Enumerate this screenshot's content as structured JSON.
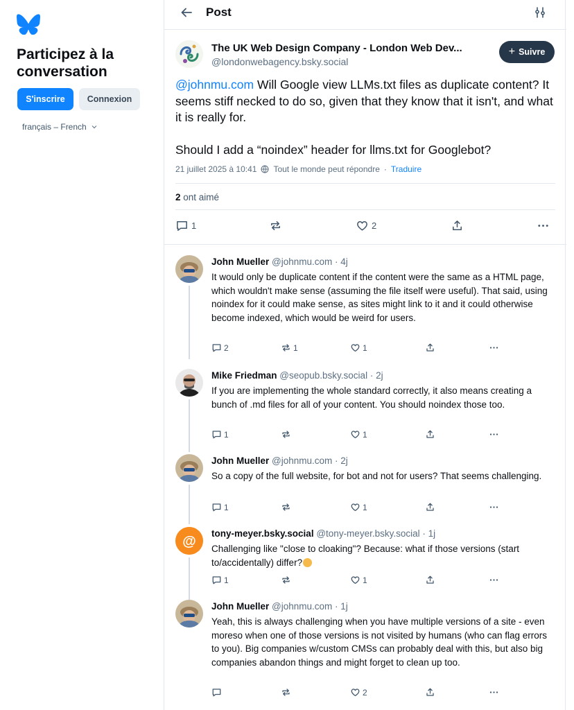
{
  "sidebar": {
    "title": "Participez à la conversation",
    "signup_label": "S'inscrire",
    "login_label": "Connexion",
    "language": "français – French"
  },
  "header": {
    "title": "Post"
  },
  "post": {
    "author_name": "The UK Web Design Company - London Web Dev...",
    "author_handle": "@londonwebagency.bsky.social",
    "follow_label": "Suivre",
    "mention": "@johnmu.com",
    "text_part1": " Will Google view LLMs.txt files as duplicate content? It seems stiff necked to do so, given that they know that it isn't, and what it is really for.",
    "text_part2": "Should I add a “noindex” header for llms.txt for Googlebot?",
    "date": "21 juillet 2025 à 10:41",
    "reply_setting": "Tout le monde peut répondre",
    "separator": "·",
    "translate": "Traduire",
    "likes_count": "2",
    "likes_label": "ont aimé",
    "reply_count": "1",
    "repost_count": "",
    "like_count": "2"
  },
  "replies": [
    {
      "name": "John Mueller",
      "handle": "@johnmu.com",
      "time": "· 4j",
      "text": "It would only be duplicate content if the content were the same as a HTML page, which wouldn't make sense (assuming the file itself were useful). That said, using noindex for it could make sense, as sites might link to it and it could otherwise become indexed, which would be weird for users.",
      "replies": "2",
      "reposts": "1",
      "likes": "1"
    },
    {
      "name": "Mike Friedman",
      "handle": "@seopub.bsky.social",
      "time": "· 2j",
      "text": "If you are implementing the whole standard correctly, it also means creating a bunch of .md files for all of your content. You should noindex those too.",
      "replies": "1",
      "reposts": "",
      "likes": "1"
    },
    {
      "name": "John Mueller",
      "handle": "@johnmu.com",
      "time": "· 2j",
      "text": "So a copy of the full website, for bot and not for users? That seems challenging.",
      "replies": "1",
      "reposts": "",
      "likes": "1"
    },
    {
      "name": "tony-meyer.bsky.social",
      "handle": "@tony-meyer.bsky.social",
      "time": "· 1j",
      "text": "Challenging like \"close to cloaking\"? Because: what if those versions (start to/accidentally) differ?",
      "replies": "1",
      "reposts": "",
      "likes": "1"
    },
    {
      "name": "John Mueller",
      "handle": "@johnmu.com",
      "time": "· 1j",
      "text": "Yeah, this is always challenging when you have multiple versions of a site - even moreso when one of those versions is not visited by humans (who can flag errors to you). Big companies w/custom CMSs can probably deal with this, but also big companies abandon things and might forget to clean up too.",
      "replies": "",
      "reposts": "",
      "likes": "2"
    }
  ],
  "icons": {
    "logo": "butterfly-icon",
    "back": "arrow-left-icon",
    "filter": "sliders-icon",
    "reply": "speech-bubble-icon",
    "repost": "repost-arrows-icon",
    "like": "heart-icon",
    "share": "share-icon",
    "more": "ellipsis-icon",
    "globe": "globe-icon",
    "emoji": "smiley-emoji-icon"
  },
  "colors": {
    "accent": "#1083fe",
    "follow_bg": "#27374a",
    "muted": "#5c6f82"
  }
}
